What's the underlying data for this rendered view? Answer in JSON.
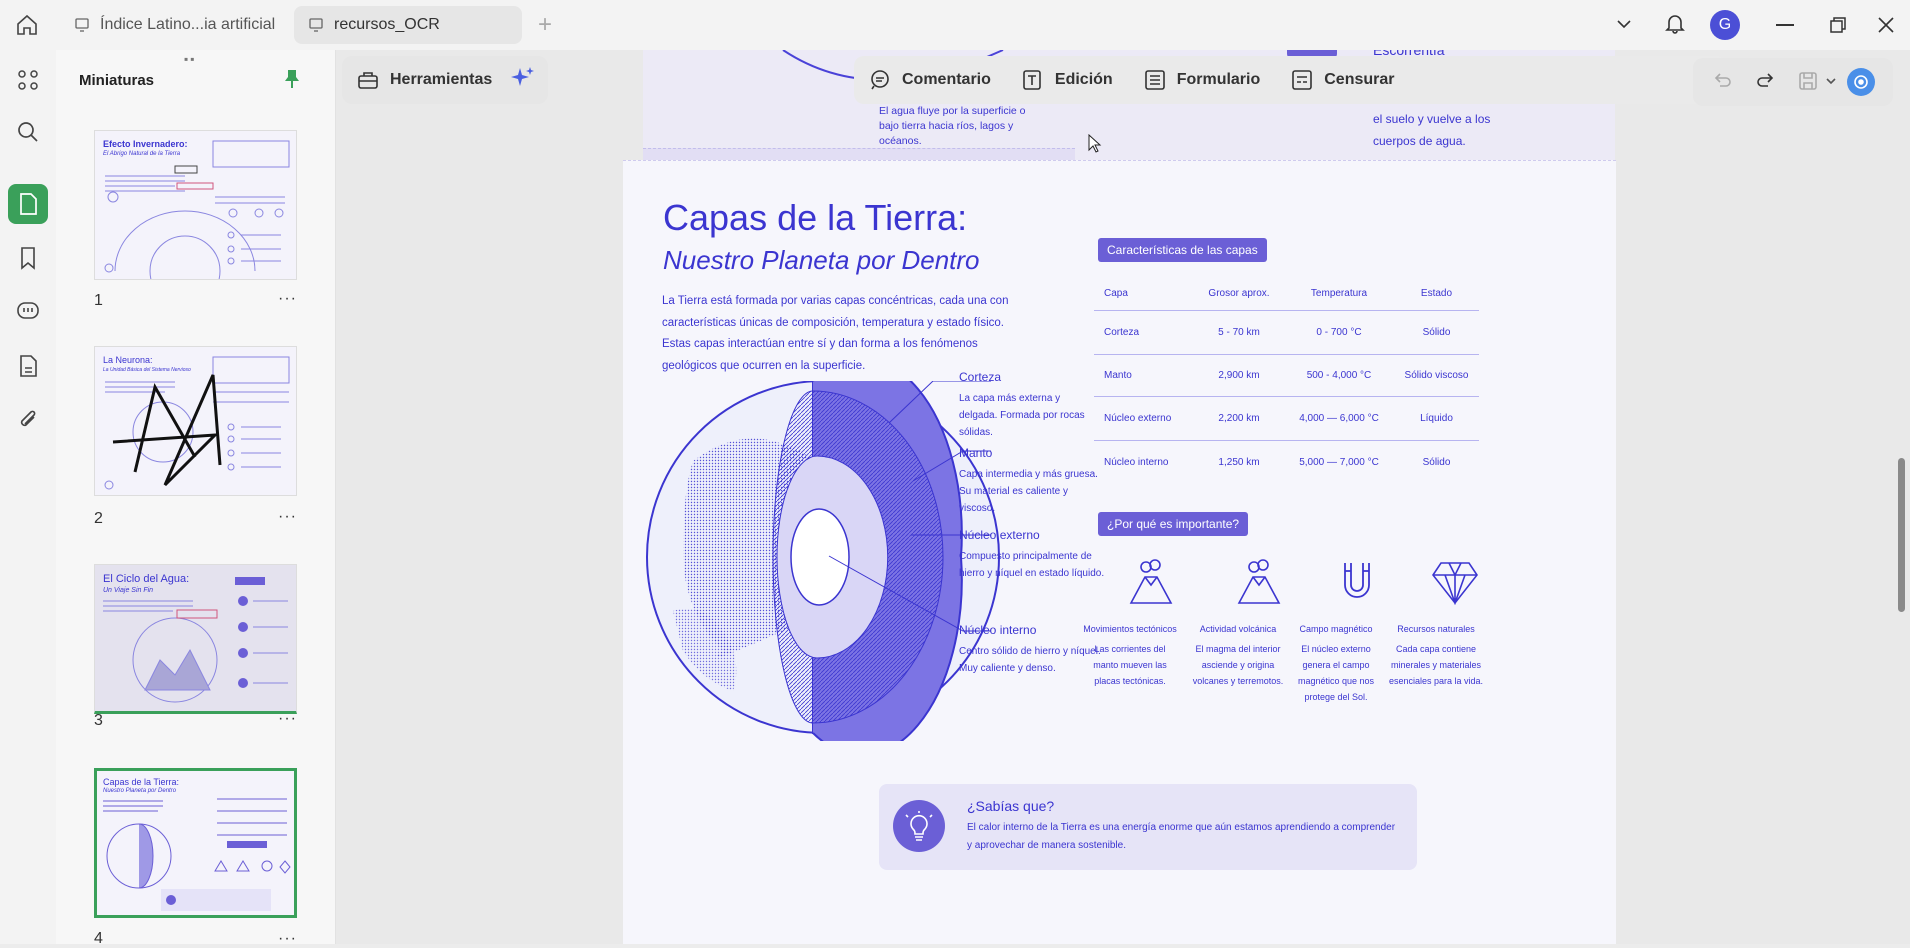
{
  "browser": {
    "tabs": [
      {
        "label": "Índice Latino...ia artificial"
      },
      {
        "label": "recursos_OCR"
      }
    ],
    "new_tab": "+",
    "avatar": "G"
  },
  "panel": {
    "title": "Miniaturas",
    "pages": [
      {
        "num": "1",
        "title": "Efecto Invernadero:",
        "subtitle": "El Abrigo Natural de la Tierra"
      },
      {
        "num": "2",
        "title": "La Neurona:",
        "subtitle": "La Unidad Básica del Sistema Nervioso"
      },
      {
        "num": "3",
        "title": "El Ciclo del Agua:",
        "subtitle": "Un Viaje Sin Fin"
      },
      {
        "num": "4",
        "title": "Capas de la Tierra:",
        "subtitle": "Nuestro Planeta por Dentro"
      }
    ],
    "more": "···"
  },
  "toolbar": {
    "herramientas": "Herramientas",
    "comentario": "Comentario",
    "edicion": "Edición",
    "formulario": "Formulario",
    "censurar": "Censurar"
  },
  "prev_page": {
    "water_text": "El agua fluye por la superficie o bajo tierra hacia ríos, lagos y océanos.",
    "escorrentia_title": "Escorrentía",
    "escorrentia_text": "El agua se desliza por la superficie o se infiltra en el suelo y vuelve a los cuerpos de agua."
  },
  "page": {
    "title": "Capas de la Tierra:",
    "subtitle": "Nuestro Planeta por Dentro",
    "intro": "La Tierra está formada por varias capas concéntricas, cada una con características únicas de composición, temperatura y estado físico. Estas capas interactúan entre sí y dan forma a los fenómenos geológicos que ocurren en la superficie.",
    "layers": [
      {
        "name": "Corteza",
        "desc": "La capa más externa y delgada. Formada por rocas sólidas."
      },
      {
        "name": "Manto",
        "desc": "Capa intermedia y más gruesa. Su material es caliente y viscoso."
      },
      {
        "name": "Núcleo externo",
        "desc": "Compuesto principalmente de hierro y níquel en estado líquido."
      },
      {
        "name": "Núcleo interno",
        "desc": "Centro sólido de hierro y níquel. Muy caliente y denso."
      }
    ],
    "table_title": "Características de las capas",
    "table_headers": [
      "Capa",
      "Grosor aprox.",
      "Temperatura",
      "Estado"
    ],
    "table_rows": [
      [
        "Corteza",
        "5 - 70 km",
        "0 - 700 °C",
        "Sólido"
      ],
      [
        "Manto",
        "2,900 km",
        "500 - 4,000 °C",
        "Sólido viscoso"
      ],
      [
        "Núcleo externo",
        "2,200 km",
        "4,000 — 6,000 °C",
        "Líquido"
      ],
      [
        "Núcleo interno",
        "1,250 km",
        "5,000 — 7,000 °C",
        "Sólido"
      ]
    ],
    "importance_title": "¿Por qué es importante?",
    "importance": [
      {
        "title": "Movimientos tectónicos",
        "desc": "Las corrientes del manto mueven las placas tectónicas."
      },
      {
        "title": "Actividad volcánica",
        "desc": "El magma del interior asciende y origina volcanes y terremotos."
      },
      {
        "title": "Campo magnético",
        "desc": "El núcleo externo genera el campo magnético que nos protege del Sol."
      },
      {
        "title": "Recursos naturales",
        "desc": "Cada capa contiene minerales y materiales esenciales para la vida."
      }
    ],
    "fact_title": "¿Sabías que?",
    "fact_text_1": "El calor interno de la Tierra es una energía enorme que aún estamos aprendiendo a comprender",
    "fact_text_2": "y aprovechar de manera sostenible."
  }
}
